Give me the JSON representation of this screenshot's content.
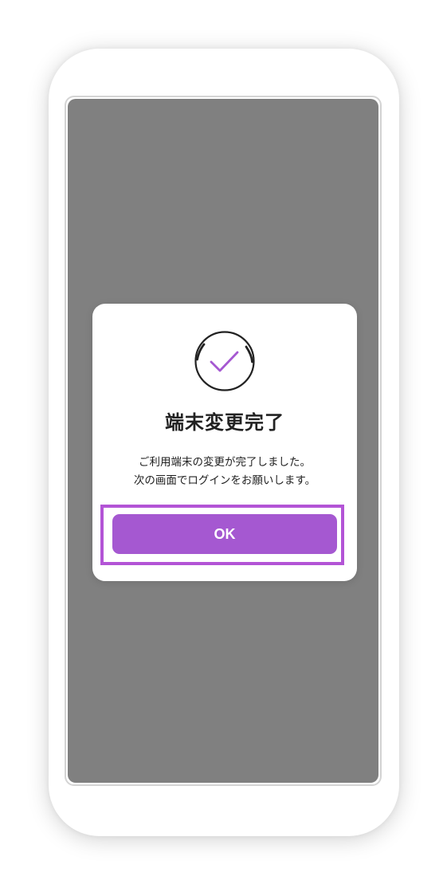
{
  "dialog": {
    "icon": "check-circle-icon",
    "title": "端末変更完了",
    "message_line1": "ご利用端末の変更が完了しました。",
    "message_line2": "次の画面でログインをお願いします。",
    "ok_label": "OK"
  },
  "colors": {
    "accent": "#a558d1",
    "highlight": "#b354d6",
    "overlay": "#808080"
  }
}
